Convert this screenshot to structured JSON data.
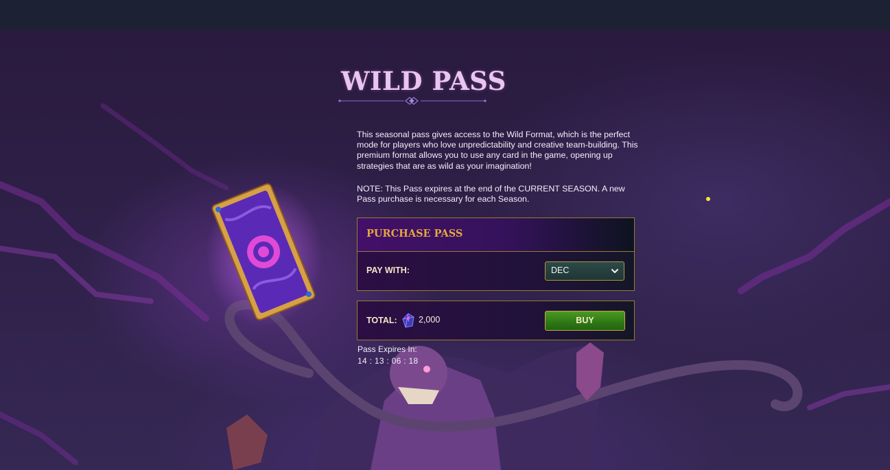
{
  "page": {
    "title": "WILD PASS",
    "description": "This seasonal pass gives access to the Wild Format, which is the perfect mode for players who love unpredictability and creative team-building. This premium format allows you to use any card in the game, opening up strategies that are as wild as your imagination!",
    "note": "NOTE: This Pass expires at the end of the CURRENT SEASON. A new Pass purchase is necessary for each Season."
  },
  "purchase": {
    "header": "PURCHASE PASS",
    "pay_with_label": "PAY WITH:",
    "currency_selected": "DEC",
    "total_label": "TOTAL:",
    "total_icon": "dec-gem-icon",
    "total_value": "2,000",
    "buy_label": "BUY"
  },
  "expiry": {
    "label": "Pass Expires In:",
    "countdown": "14 : 13 : 06 : 18"
  },
  "colors": {
    "title": "#e9c6ee",
    "header_text": "#e5a640",
    "panel_border": "#9a7d2e",
    "buy_button": "#2f7a16",
    "top_bar": "#1c2233"
  }
}
